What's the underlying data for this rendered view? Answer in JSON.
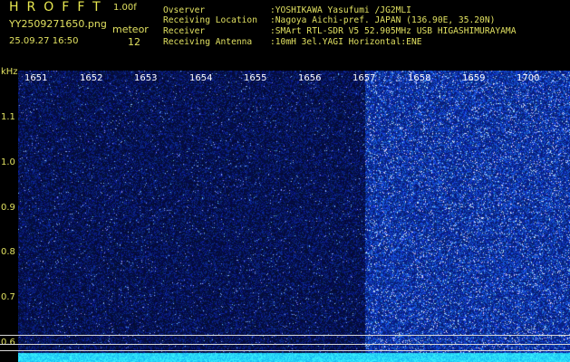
{
  "header": {
    "app_title": "HROFFT",
    "version": "1.00f",
    "file_name": "YY2509271650.png",
    "mode": "meteor",
    "timestamp": "25.09.27 16:50",
    "count": "12"
  },
  "station_info": [
    {
      "label": "Ovserver",
      "value": ":YOSHIKAWA Yasufumi /JG2MLI"
    },
    {
      "label": "Receiving Location",
      "value": ":Nagoya Aichi-pref. JAPAN (136.90E, 35.20N)"
    },
    {
      "label": "Receiver",
      "value": ":SMArt RTL-SDR V5 52.905MHz USB HIGASHIMURAYAMA"
    },
    {
      "label": "Receiving Antenna",
      "value": ":10mH 3el.YAGI Horizontal:ENE"
    }
  ],
  "spectrogram": {
    "unit": "kHz",
    "y_ticks": [
      "1.1",
      "1.0",
      "0.9",
      "0.8",
      "0.7",
      "0.6"
    ],
    "x_ticks": [
      "1651",
      "1652",
      "1653",
      "1654",
      "1655",
      "1656",
      "1657",
      "1658",
      "1659",
      "1700"
    ],
    "colors": {
      "background": "#000000",
      "noise_low": "#0a0a50",
      "noise_high": "#3a5aff",
      "baseline": "#20d0ff"
    }
  }
}
